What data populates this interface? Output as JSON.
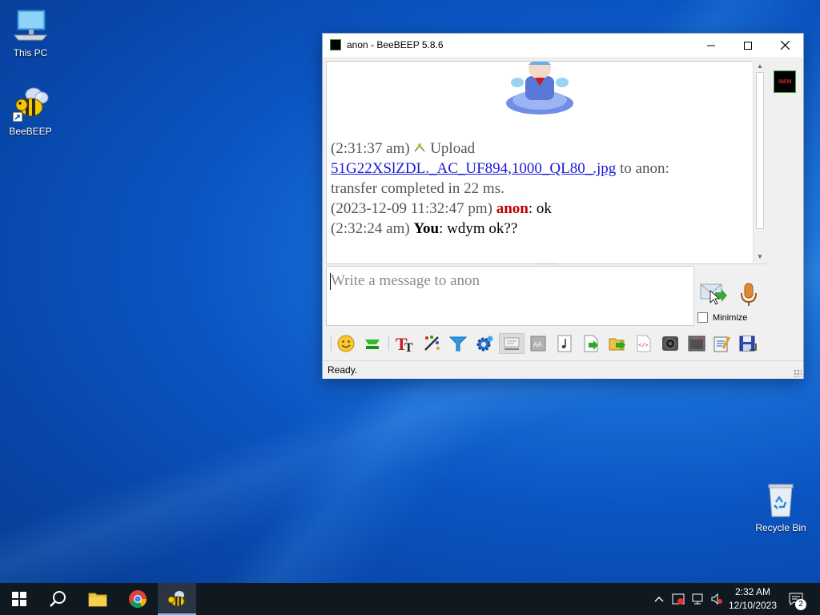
{
  "desktop": {
    "icons": [
      {
        "label": "This PC"
      },
      {
        "label": "BeeBEEP"
      },
      {
        "label": "Recycle Bin"
      }
    ]
  },
  "window": {
    "title": "anon - BeeBEEP 5.8.6",
    "controls": {
      "minimize": "—",
      "maximize": "☐",
      "close": "✕"
    }
  },
  "chat": {
    "upload_time": "(2:31:37 am)",
    "upload_label": "Upload",
    "file_link": "51G22XSlZDL._AC_UF894,1000_QL80_.jpg",
    "upload_to": "to anon:",
    "upload_result": "transfer completed in 22 ms.",
    "msg1_time": "(2023-12-09 11:32:47 pm)",
    "msg1_user": "anon",
    "msg1_text": ": ok",
    "msg2_time": "(2:32:24 am)",
    "msg2_user": "You",
    "msg2_text": ": wdym ok??"
  },
  "composer": {
    "placeholder": "Write a message to anon",
    "minimize_label": "Minimize"
  },
  "avatar_text": "ANON",
  "toolbar": {
    "buttons": [
      "emoticons-icon",
      "highlight-icon",
      "font-icon",
      "color-picker-icon",
      "filter-icon",
      "settings-icon",
      "compact-view-icon",
      "font-size-icon",
      "music-icon",
      "send-file-icon",
      "send-folder-icon",
      "html-code-icon",
      "screenshot-icon",
      "history-icon",
      "save-chat-icon",
      "clear-chat-icon"
    ]
  },
  "status": {
    "text": "Ready."
  },
  "taskbar": {
    "time": "2:32 AM",
    "date": "12/10/2023",
    "notification_count": "2"
  },
  "colors": {
    "accent": "#1a1ad6",
    "anon_user": "#c00000",
    "taskbar": "#101820"
  }
}
